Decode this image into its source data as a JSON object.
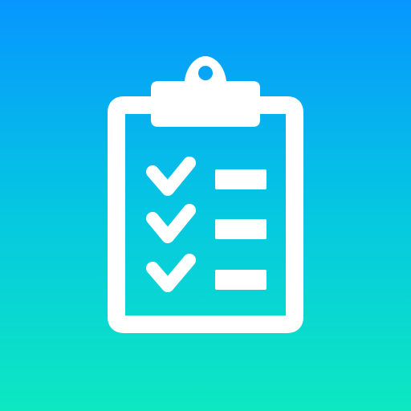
{
  "app_icon": {
    "icon_name": "clipboard-checklist-icon",
    "background_gradient": {
      "top_color": "#0796FF",
      "middle_color": "#05C6E2",
      "bottom_color": "#0DE8C1"
    },
    "glyph_color": "#FFFFFF",
    "checklist": {
      "items": [
        {
          "checked": true,
          "icon": "checkmark-icon"
        },
        {
          "checked": true,
          "icon": "checkmark-icon"
        },
        {
          "checked": true,
          "icon": "checkmark-icon"
        }
      ]
    }
  }
}
